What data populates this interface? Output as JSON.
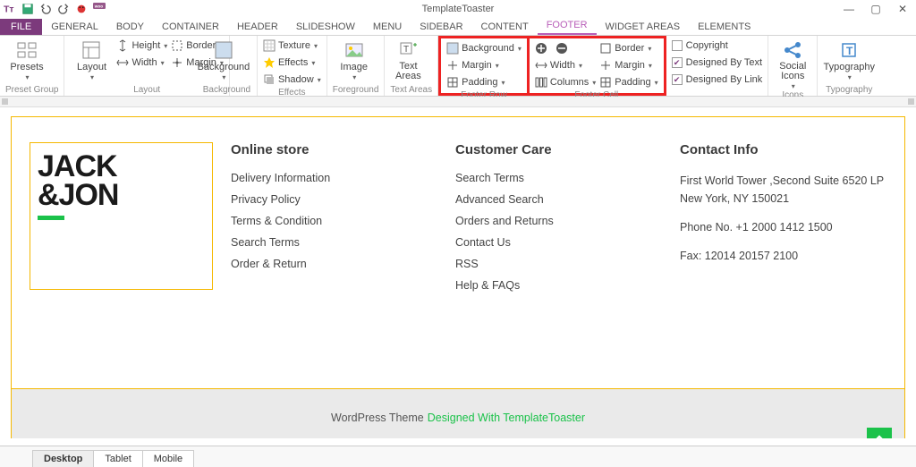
{
  "app": {
    "title": "TemplateToaster"
  },
  "qat": [
    "tt",
    "save",
    "undo",
    "redo",
    "bug",
    "w"
  ],
  "titlebar_buttons": {
    "min": "—",
    "max": "▢",
    "close": "✕"
  },
  "file_tab": "FILE",
  "tabs": [
    "GENERAL",
    "BODY",
    "CONTAINER",
    "HEADER",
    "SLIDESHOW",
    "MENU",
    "SIDEBAR",
    "CONTENT",
    "FOOTER",
    "WIDGET AREAS",
    "ELEMENTS"
  ],
  "active_tab": "FOOTER",
  "ribbon": {
    "preset_group": {
      "label": "Preset Group",
      "presets": "Presets"
    },
    "layout": {
      "label": "Layout",
      "layout_btn": "Layout",
      "height": "Height",
      "width": "Width",
      "border": "Border",
      "margin": "Margin"
    },
    "background": {
      "label": "Background",
      "btn": "Background"
    },
    "effects": {
      "label": "Effects",
      "texture": "Texture",
      "effects": "Effects",
      "shadow": "Shadow"
    },
    "foreground": {
      "label": "Foreground",
      "image": "Image"
    },
    "text_areas": {
      "label": "Text Areas",
      "btn": "Text\nAreas"
    },
    "footer_row": {
      "label": "Footer Row",
      "background": "Background",
      "margin": "Margin",
      "padding": "Padding"
    },
    "footer_cell": {
      "label": "Footer Cell",
      "width": "Width",
      "columns": "Columns",
      "border": "Border",
      "margin": "Margin",
      "padding": "Padding"
    },
    "links": {
      "copyright": "Copyright",
      "designed_text": "Designed By Text",
      "designed_link": "Designed By Link"
    },
    "social": {
      "label": "Icons",
      "btn": "Social\nIcons"
    },
    "typography": {
      "label": "Typography",
      "btn": "Typography"
    }
  },
  "footer": {
    "logo_line1": "JACK",
    "logo_line2": "&JON",
    "col1": {
      "title": "Online store",
      "links": [
        "Delivery Information",
        "Privacy Policy",
        "Terms & Condition",
        "Search Terms",
        "Order & Return"
      ]
    },
    "col2": {
      "title": "Customer Care",
      "links": [
        "Search Terms",
        "Advanced Search",
        "Orders and Returns",
        "Contact Us",
        "RSS",
        "Help & FAQs"
      ]
    },
    "col3": {
      "title": "Contact Info",
      "addr": "First World Tower ,Second Suite 6520 LP New York, NY 150021",
      "phone": "Phone No. +1 2000 1412 1500",
      "fax": "Fax: 12014 20157 2100"
    },
    "credit_prefix": "WordPress Theme",
    "credit_link": "Designed With TemplateToaster"
  },
  "view_tabs": [
    "Desktop",
    "Tablet",
    "Mobile"
  ],
  "active_view": "Desktop"
}
